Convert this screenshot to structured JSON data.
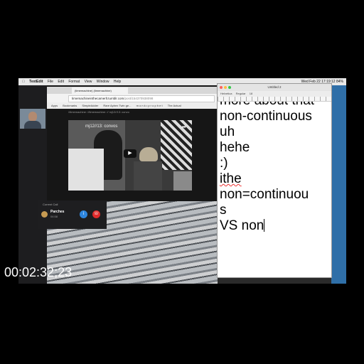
{
  "menubar": {
    "app_name": "TextEdit",
    "items": [
      "File",
      "Edit",
      "Format",
      "View",
      "Window",
      "Help"
    ],
    "status": "Wed Feb 22  17:19:12   84%"
  },
  "call": {
    "current_label": "Current Call",
    "caller_name": "Parches",
    "duration": "04:58"
  },
  "browser": {
    "tab_label": "(timemachine) (timemachine)",
    "url_host": "timemachineinthecamerlt.tumblr.com",
    "url_path": "/post/154370938098",
    "bookmarks": [
      "Apps",
      "Bookmarks",
      "SimpleAdder",
      "Rare Aphex Twin ge...",
      "m o n k • p r o p h e t",
      "The Actual"
    ],
    "page_strip": "//timemachine: //timemachine: // mj12//13: convo"
  },
  "video": {
    "title": "mj12//13: convos"
  },
  "textedit": {
    "title": "Untitled 2",
    "toolbar": [
      "Helvetica",
      "Regular",
      "18"
    ],
    "lines": [
      "more about that",
      "non-continuous",
      "uh",
      "hehe",
      ":)",
      "ithe",
      "non=continuou",
      "s",
      "VS non"
    ]
  },
  "overlay": {
    "timecode": "00:02:32;23"
  },
  "colors": {
    "call_accept": "#2e86de",
    "call_end": "#e02a2a",
    "desktop_blue": "#2f6fa8"
  }
}
